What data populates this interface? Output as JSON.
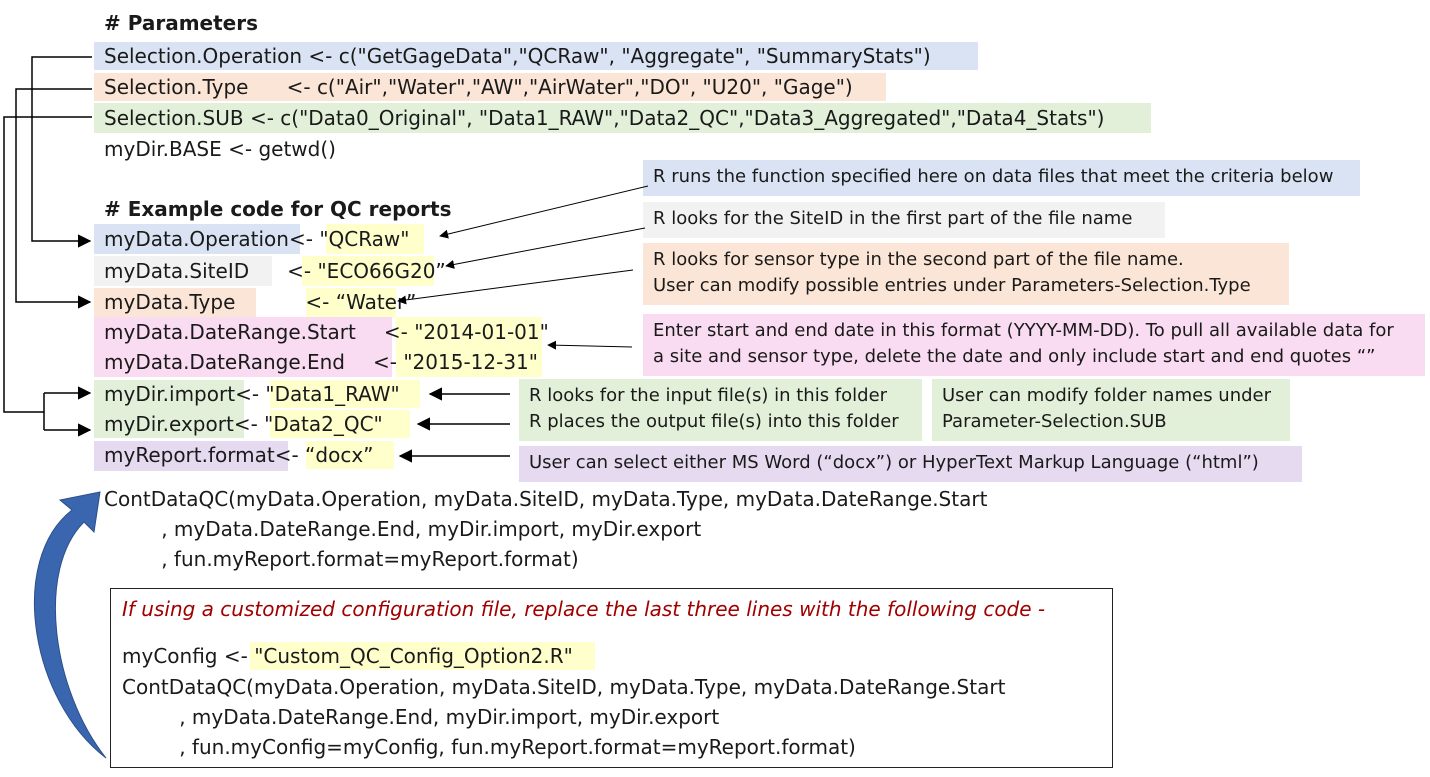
{
  "params_header": "# Parameters",
  "sel_operation": "Selection.Operation <- c(\"GetGageData\",\"QCRaw\", \"Aggregate\", \"SummaryStats\")",
  "sel_type": "Selection.Type      <- c(\"Air\",\"Water\",\"AW\",\"AirWater\",\"DO\", \"U20\", \"Gage\")",
  "sel_sub": "Selection.SUB <- c(\"Data0_Original\", \"Data1_RAW\",\"Data2_QC\",\"Data3_Aggregated\",\"Data4_Stats\")",
  "mydir_base": "myDir.BASE <- getwd()",
  "example_header": "# Example code for QC reports",
  "vars": {
    "operation": {
      "name": "myData.Operation",
      "arrow": "<- ",
      "value": "\"QCRaw\""
    },
    "siteid": {
      "name": "myData.SiteID",
      "arrow": "<- ",
      "value": "\"ECO66G20”"
    },
    "type": {
      "name": "myData.Type",
      "arrow": "<- ",
      "value": "“Water”"
    },
    "start": {
      "name": "myData.DateRange.Start",
      "arrow": "<- ",
      "value": "\"2014-01-01\""
    },
    "end": {
      "name": "myData.DateRange.End",
      "arrow": "<- ",
      "value": "\"2015-12-31\""
    },
    "import": {
      "name": "myDir.import",
      "arrow": "<- ",
      "value": "\"Data1_RAW\""
    },
    "export": {
      "name": "myDir.export",
      "arrow": "<- ",
      "value": "\"Data2_QC\""
    },
    "report": {
      "name": "myReport.format",
      "arrow": "<- ",
      "value": "“docx”"
    }
  },
  "notes": {
    "operation": "R runs the function specified here on data files that meet the criteria below",
    "siteid": "R looks for the SiteID in the first part of the file name",
    "type": "R looks for sensor type in the second part of the file name.\nUser can modify possible entries under Parameters-Selection.Type",
    "dates": "Enter start and end date in this format (YYYY-MM-DD). To pull all available data for\na site and sensor type, delete the date and only include start and end quotes “”",
    "folders": "R looks for the input file(s) in this folder\nR places the output file(s) into this folder",
    "folders_sub": "User can modify folder names under\nParameter-Selection.SUB",
    "report": "User can select either MS Word (“docx”) or HyperText Markup Language (“html”)"
  },
  "call_lines": [
    "ContDataQC(myData.Operation, myData.SiteID, myData.Type, myData.DateRange.Start",
    "         , myData.DateRange.End, myDir.import, myDir.export",
    "         , fun.myReport.format=myReport.format)"
  ],
  "custom": {
    "intro": "If using a customized configuration file, replace the last three lines with the following code -",
    "config_prefix": "myConfig <- ",
    "config_value": "\"Custom_QC_Config_Option2.R\"",
    "lines": [
      "ContDataQC(myData.Operation, myData.SiteID, myData.Type, myData.DateRange.Start",
      "         , myData.DateRange.End, myDir.import, myDir.export",
      "         , fun.myConfig=myConfig, fun.myReport.format=myReport.format)"
    ]
  },
  "colors": {
    "blue": "#dae3f3",
    "peach": "#fbe5d6",
    "green": "#e2f0d9",
    "gray": "#f2f2f2",
    "pink": "#fadcf2",
    "purple": "#e5daf0",
    "yellow": "#ffffcc",
    "red_text": "#a00000",
    "curved_arrow": "#3a66b0"
  }
}
